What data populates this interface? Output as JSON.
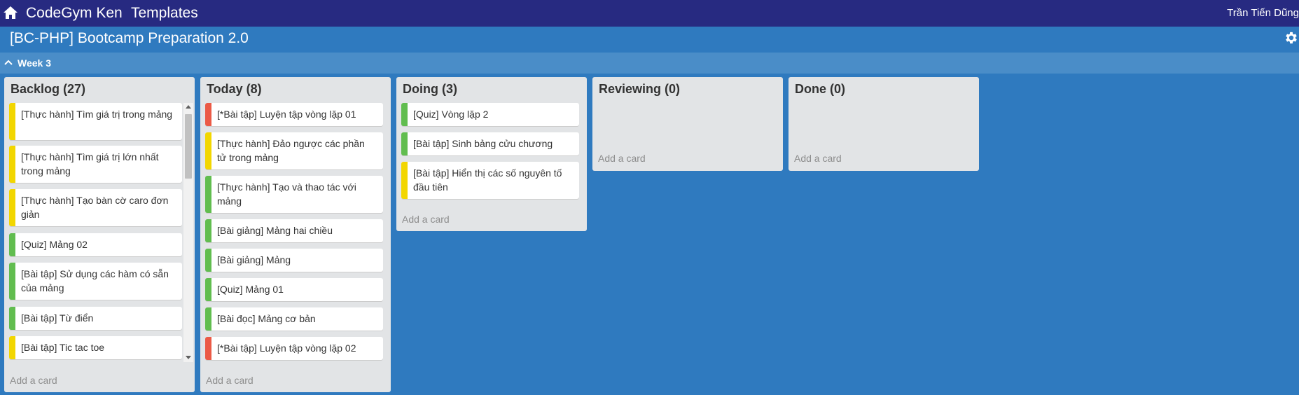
{
  "topbar": {
    "brand": "CodeGym Ken",
    "templates": "Templates",
    "user": "Trần Tiến Dũng",
    "icons": [
      "home-icon"
    ]
  },
  "board": {
    "title": "[BC-PHP] Bootcamp Preparation 2.0",
    "icons": [
      "gear-icon"
    ]
  },
  "week": {
    "label": "Week 3",
    "icons": [
      "chevron-up-icon"
    ]
  },
  "colors": {
    "yellow": "#f2d600",
    "green": "#61bd4f",
    "red": "#eb5a46"
  },
  "add_card_label": "Add a card",
  "lists": [
    {
      "title": "Backlog (27)",
      "cards": [
        {
          "text": "[Thực hành] Tìm giá trị trong mảng",
          "label": "yellow"
        },
        {
          "text": "[Thực hành] Tìm giá trị lớn nhất trong mảng",
          "label": "yellow"
        },
        {
          "text": "[Thực hành] Tạo bàn cờ caro đơn giản",
          "label": "yellow"
        },
        {
          "text": "[Quiz] Mảng 02",
          "label": "green"
        },
        {
          "text": "[Bài tập] Sử dụng các hàm có sẵn của mảng",
          "label": "green"
        },
        {
          "text": "[Bài tập] Từ điển",
          "label": "green"
        },
        {
          "text": "[Bài tập] Tic tac toe",
          "label": "yellow"
        }
      ]
    },
    {
      "title": "Today (8)",
      "cards": [
        {
          "text": "[*Bài tập] Luyện tập vòng lặp 01",
          "label": "red"
        },
        {
          "text": "[Thực hành] Đảo ngược các phần tử trong mảng",
          "label": "yellow"
        },
        {
          "text": "[Thực hành] Tạo và thao tác với mảng",
          "label": "green"
        },
        {
          "text": "[Bài giảng] Mảng hai chiều",
          "label": "green"
        },
        {
          "text": "[Bài giảng] Mảng",
          "label": "green"
        },
        {
          "text": "[Quiz] Mảng 01",
          "label": "green"
        },
        {
          "text": "[Bài đọc] Mảng cơ bản",
          "label": "green"
        },
        {
          "text": "[*Bài tập] Luyện tập vòng lặp 02",
          "label": "red"
        }
      ]
    },
    {
      "title": "Doing (3)",
      "cards": [
        {
          "text": "[Quiz] Vòng lặp 2",
          "label": "green"
        },
        {
          "text": "[Bài tập] Sinh bảng cửu chương",
          "label": "green"
        },
        {
          "text": "[Bài tập] Hiển thị các số nguyên tố đầu tiên",
          "label": "yellow"
        }
      ]
    },
    {
      "title": "Reviewing (0)",
      "cards": []
    },
    {
      "title": "Done (0)",
      "cards": []
    }
  ]
}
